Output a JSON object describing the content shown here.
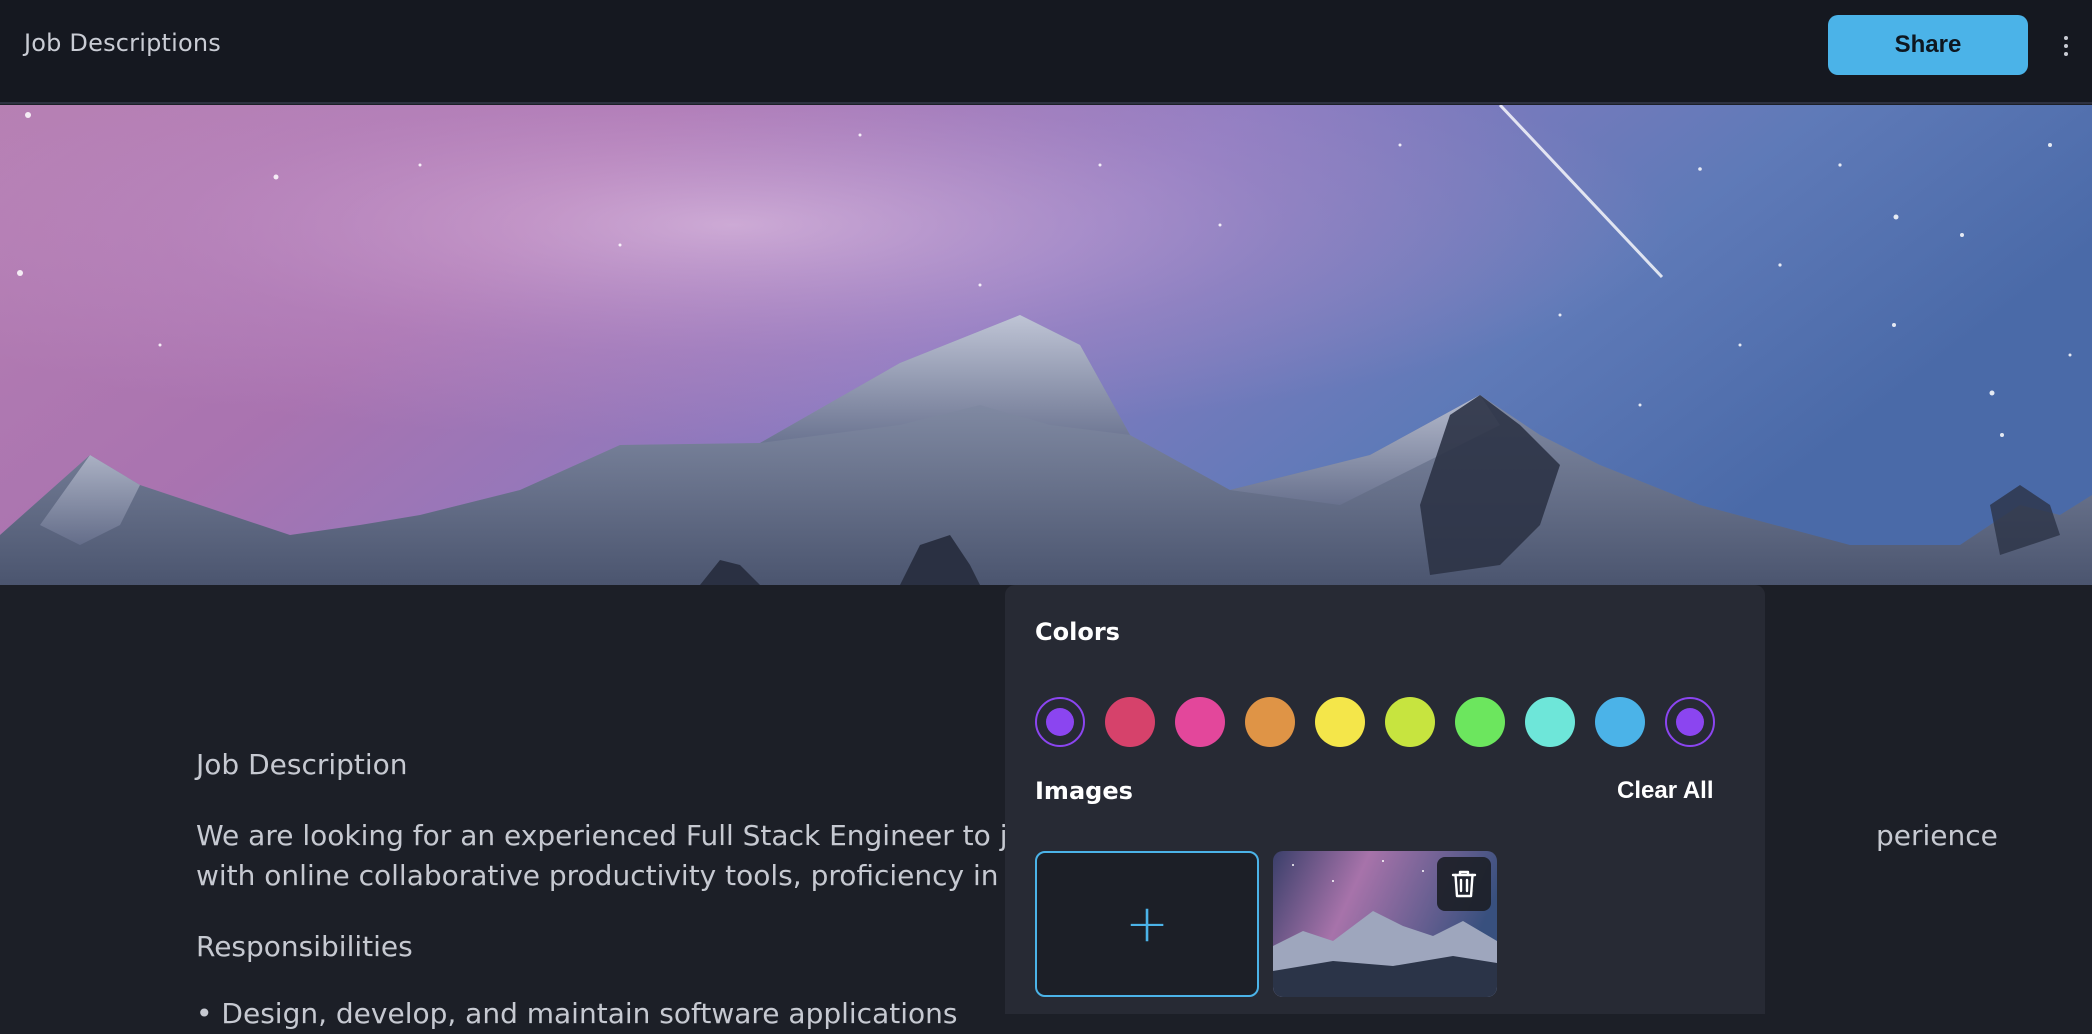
{
  "header": {
    "title": "Job Descriptions",
    "share_label": "Share",
    "more_icon": "more-vertical-icon"
  },
  "banner": {
    "description": "night-sky-mountains"
  },
  "document": {
    "heading": "Job Description",
    "intro_line1": "We are looking for an experienced Full Stack Engineer to jo",
    "intro_line1_tail": "perience",
    "intro_line2": "with online collaborative productivity tools, proficiency in R",
    "responsibilities_heading": "Responsibilities",
    "bullet_partial": "• Design, develop, and maintain software applications"
  },
  "cover_panel": {
    "colors_title": "Colors",
    "colors": [
      {
        "name": "violet",
        "hex": "#8b45f0",
        "selected": true
      },
      {
        "name": "crimson",
        "hex": "#d6426b"
      },
      {
        "name": "pink",
        "hex": "#e3479b"
      },
      {
        "name": "orange",
        "hex": "#df9446"
      },
      {
        "name": "yellow",
        "hex": "#f4e64a"
      },
      {
        "name": "lime",
        "hex": "#c7e43f"
      },
      {
        "name": "green",
        "hex": "#6ce65e"
      },
      {
        "name": "teal",
        "hex": "#6ee6d9"
      },
      {
        "name": "sky",
        "hex": "#4bb3e8"
      },
      {
        "name": "violet-2",
        "hex": "#8b45f0",
        "selected": true
      }
    ],
    "images_title": "Images",
    "clear_all_label": "Clear All",
    "add_label": "+",
    "trash_icon": "trash-icon"
  },
  "theme": {
    "accent": "#4bb3e8",
    "bg": "#1c1f27",
    "topbar_bg": "#151820",
    "panel_bg": "#272a34"
  }
}
